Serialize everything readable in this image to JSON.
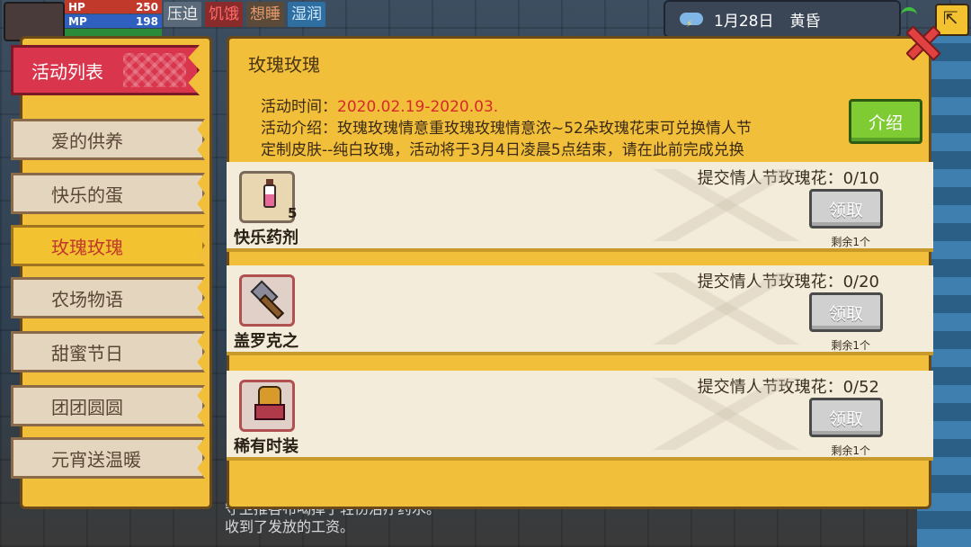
{
  "hud": {
    "hp_label": "HP",
    "hp_value": "250",
    "mp_label": "MP",
    "mp_value": "198",
    "statuses": [
      "压迫",
      "饥饿",
      "想睡",
      "湿润"
    ],
    "date": "1月28日",
    "time_of_day": "黄昏"
  },
  "sidebar": {
    "title": "活动列表",
    "items": [
      {
        "label": "爱的供养"
      },
      {
        "label": "快乐的蛋"
      },
      {
        "label": "玫瑰玫瑰"
      },
      {
        "label": "农场物语"
      },
      {
        "label": "甜蜜节日"
      },
      {
        "label": "团团圆圆"
      },
      {
        "label": "元宵送温暖"
      }
    ]
  },
  "event": {
    "title": "玫瑰玫瑰",
    "time_label": "活动时间：",
    "time_value": "2020.02.19-2020.03.",
    "intro_line1": "活动介绍：玫瑰玫瑰情意重玫瑰玫瑰情意浓~52朵玫瑰花束可兑换情人节",
    "intro_line2": "定制皮肤--纯白玫瑰，活动将于3月4日凌晨5点结束，请在此前完成兑换",
    "intro_button": "介绍"
  },
  "rewards": [
    {
      "requirement": "提交情人节玫瑰花：0/10",
      "item_name": "快乐药剂",
      "count": "5",
      "claim_label": "领取",
      "remaining": "剩余1个"
    },
    {
      "requirement": "提交情人节玫瑰花：0/20",
      "item_name": "盖罗克之",
      "count": "",
      "claim_label": "领取",
      "remaining": "剩余1个"
    },
    {
      "requirement": "提交情人节玫瑰花：0/52",
      "item_name": "稀有时装",
      "count": "",
      "claim_label": "领取",
      "remaining": "剩余1个"
    }
  ],
  "background_log": {
    "line1": "守卫推各布喝掉了轻伤治疗药水。",
    "line2": "收到了发放的工资。"
  },
  "colors": {
    "panel": "#f2bf3a",
    "sidebar_header": "#d9364e",
    "active_item_text": "#c0392b",
    "time_value": "#d62a2a",
    "intro_button": "#7ecb34"
  }
}
